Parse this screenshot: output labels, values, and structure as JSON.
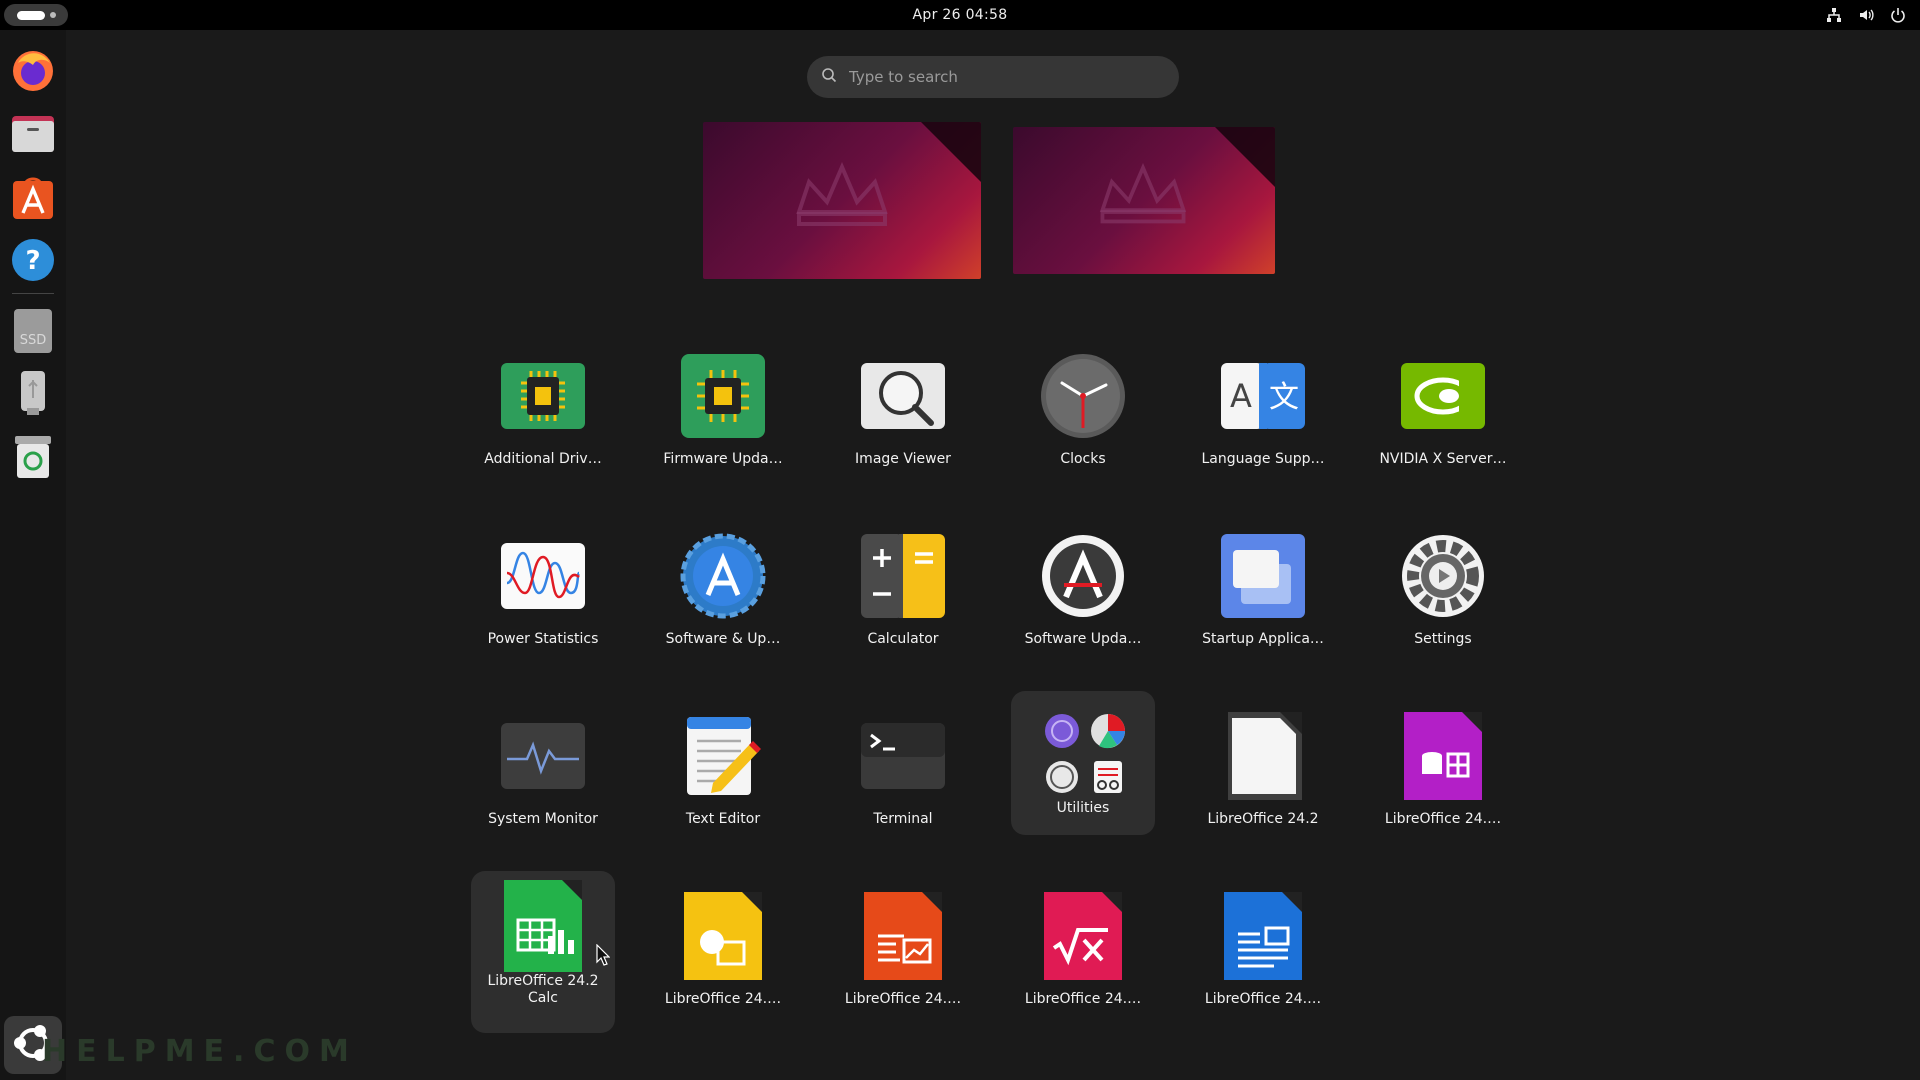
{
  "topbar": {
    "clock": "Apr 26  04:58",
    "tray_icons": [
      "network-icon",
      "volume-icon",
      "power-icon"
    ]
  },
  "dock": {
    "items": [
      "firefox-icon",
      "files-icon",
      "app-center-icon",
      "help-icon",
      "ssd-drive-icon",
      "usb-drive-icon",
      "trash-icon"
    ],
    "show_apps": "show-apps-icon"
  },
  "watermark": "HELPME.COM",
  "search": {
    "placeholder": "Type to search"
  },
  "apps": [
    {
      "label": "Additional Driv…",
      "icon": "chip-icon"
    },
    {
      "label": "Firmware Upda…",
      "icon": "firmware-chip-icon"
    },
    {
      "label": "Image Viewer",
      "icon": "image-viewer-icon"
    },
    {
      "label": "Clocks",
      "icon": "clock-icon"
    },
    {
      "label": "Language Supp…",
      "icon": "language-icon"
    },
    {
      "label": "NVIDIA X Server…",
      "icon": "nvidia-icon"
    },
    {
      "label": "Power Statistics",
      "icon": "power-stats-icon"
    },
    {
      "label": "Software & Up…",
      "icon": "software-sources-icon"
    },
    {
      "label": "Calculator",
      "icon": "calculator-icon"
    },
    {
      "label": "Software Upda…",
      "icon": "software-updater-icon"
    },
    {
      "label": "Startup Applica…",
      "icon": "startup-apps-icon"
    },
    {
      "label": "Settings",
      "icon": "settings-gear-icon"
    },
    {
      "label": "System Monitor",
      "icon": "system-monitor-icon"
    },
    {
      "label": "Text Editor",
      "icon": "text-editor-icon"
    },
    {
      "label": "Terminal",
      "icon": "terminal-icon"
    },
    {
      "label": "Utilities",
      "icon": "utilities-folder-icon"
    },
    {
      "label": "LibreOffice 24.2",
      "icon": "libreoffice-icon"
    },
    {
      "label": "LibreOffice 24.…",
      "icon": "libreoffice-base-icon"
    },
    {
      "label": "LibreOffice 24.2\nCalc",
      "icon": "libreoffice-calc-icon"
    },
    {
      "label": "LibreOffice 24.…",
      "icon": "libreoffice-draw-icon"
    },
    {
      "label": "LibreOffice 24.…",
      "icon": "libreoffice-impress-icon"
    },
    {
      "label": "LibreOffice 24.…",
      "icon": "libreoffice-math-icon"
    },
    {
      "label": "LibreOffice 24.…",
      "icon": "libreoffice-writer-icon"
    }
  ],
  "colors": {
    "accent": "#e95420",
    "background": "#1a1a1a"
  }
}
